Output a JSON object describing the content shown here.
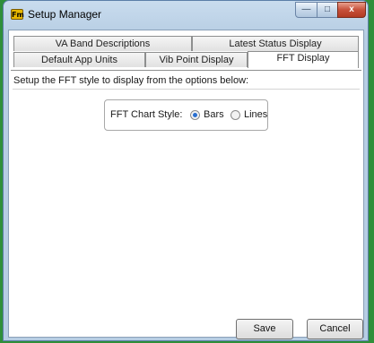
{
  "window": {
    "title": "Setup Manager",
    "app_icon_text": "Fm",
    "min_glyph": "—",
    "max_glyph": "□",
    "close_glyph": "x"
  },
  "tabs": {
    "row1": [
      {
        "label": "VA Band Descriptions"
      },
      {
        "label": "Latest Status Display"
      }
    ],
    "row2": [
      {
        "label": "Default App Units"
      },
      {
        "label": "Vib Point Display"
      },
      {
        "label": "FFT Display",
        "active": true
      }
    ]
  },
  "content": {
    "instruction": "Setup the FFT style to display from the options below:",
    "group_label": "FFT Chart Style:",
    "options": [
      {
        "label": "Bars",
        "selected": true
      },
      {
        "label": "Lines",
        "selected": false
      }
    ]
  },
  "buttons": {
    "save": "Save",
    "cancel": "Cancel"
  },
  "colors": {
    "accent": "#2a6fd0",
    "desktop": "#2f8f3a"
  }
}
